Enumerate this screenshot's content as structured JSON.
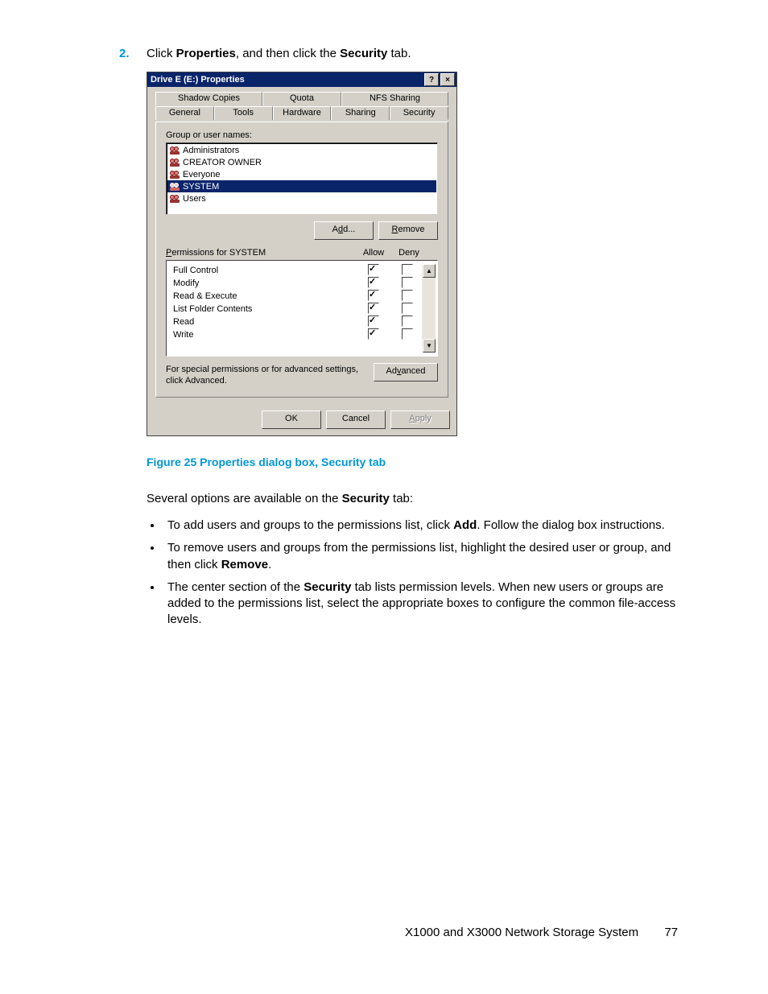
{
  "step": {
    "number": "2.",
    "text_prefix": "Click ",
    "bold1": "Properties",
    "mid": ", and then click the ",
    "bold2": "Security",
    "suffix": " tab."
  },
  "dialog": {
    "title": "Drive E (E:) Properties",
    "help_btn": "?",
    "close_btn": "×",
    "tabs_back": [
      "Shadow Copies",
      "Quota",
      "NFS Sharing"
    ],
    "tabs_front": [
      "General",
      "Tools",
      "Hardware",
      "Sharing",
      "Security"
    ],
    "active_tab": "Security",
    "group_label": "Group or user names:",
    "groups": [
      "Administrators",
      "CREATOR OWNER",
      "Everyone",
      "SYSTEM",
      "Users"
    ],
    "selected_group": "SYSTEM",
    "add_btn": "Add...",
    "remove_btn": "Remove",
    "permissions_label": "Permissions for SYSTEM",
    "col_allow": "Allow",
    "col_deny": "Deny",
    "permissions": [
      {
        "name": "Full Control",
        "allow": true,
        "deny": false
      },
      {
        "name": "Modify",
        "allow": true,
        "deny": false
      },
      {
        "name": "Read & Execute",
        "allow": true,
        "deny": false
      },
      {
        "name": "List Folder Contents",
        "allow": true,
        "deny": false
      },
      {
        "name": "Read",
        "allow": true,
        "deny": false
      },
      {
        "name": "Write",
        "allow": true,
        "deny": false
      }
    ],
    "advanced_text": "For special permissions or for advanced settings, click Advanced.",
    "advanced_btn": "Advanced",
    "ok_btn": "OK",
    "cancel_btn": "Cancel",
    "apply_btn": "Apply"
  },
  "figure_caption": "Figure 25 Properties dialog box, Security tab",
  "para_prefix": "Several options are available on the ",
  "para_bold": "Security",
  "para_suffix": " tab:",
  "bullets": [
    {
      "pre": "To add users and groups to the permissions list, click ",
      "b": "Add",
      "post": ". Follow the dialog box instructions."
    },
    {
      "pre": "To remove users and groups from the permissions list, highlight the desired user or group, and then click ",
      "b": "Remove",
      "post": "."
    },
    {
      "pre": "The center section of the ",
      "b": "Security",
      "post": " tab lists permission levels. When new users or groups are added to the permissions list, select the appropriate boxes to configure the common file-access levels."
    }
  ],
  "footer": {
    "title": "X1000 and X3000 Network Storage System",
    "page": "77"
  }
}
